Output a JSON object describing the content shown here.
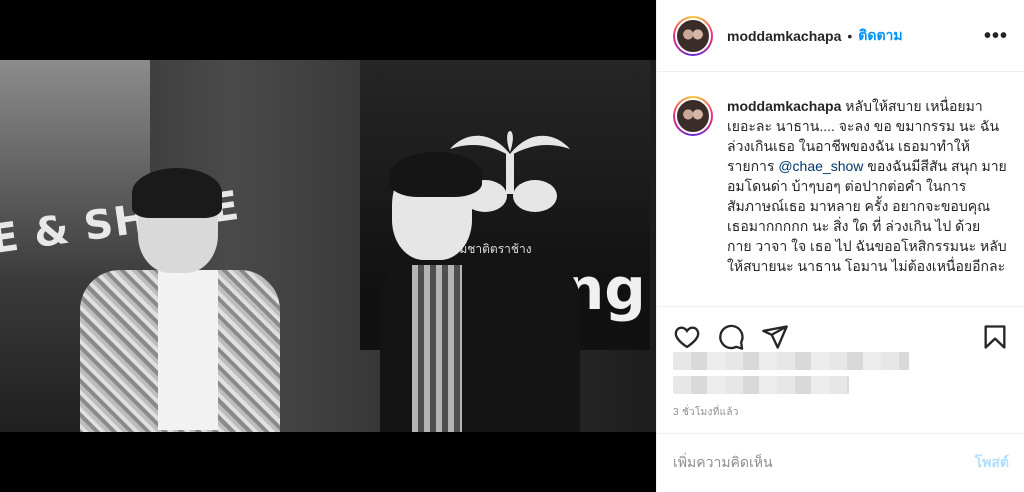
{
  "post": {
    "username": "moddamkachapa",
    "follow_label": "ติดตาม",
    "separator": "•",
    "more_label": "•••"
  },
  "photo": {
    "sign_text": "E & SHARE",
    "brand_line": "น้ำแร่ธรรมชาติตราช้าง",
    "brand_word": "Chang"
  },
  "caption": {
    "username": "moddamkachapa",
    "text_before_mention": " หลับให้สบาย เหนื่อยมาเยอะละ นาธาน.... จะลง ขอ ขมากรรม นะ ฉันล่วงเกินเธอ ในอาชีพของฉัน เธอมาทำให้รายการ ",
    "mention": "@chae_show",
    "text_after_mention": " ของฉันมีสีสัน สนุก มายอมโดนด่า บ้าๆบอๆ ต่อปากต่อคำ ในการสัมภาษณ์เธอ มาหลาย ครั้ง อยากจะขอบคุณเธอมากกกกก นะ สิ่ง ใด ที่ ล่วงเกิน ไป ด้วย กาย วาจา ใจ เธอ ไป ฉันขออโหสิกรรมนะ หลับให้สบายนะ นาธาน โอมาน ไม่ต้องเหนื่อยอีกละ"
  },
  "actions": {
    "icons": [
      "heart-icon",
      "comment-icon",
      "share-icon",
      "bookmark-icon"
    ]
  },
  "meta": {
    "time_ago": "3 ชั่วโมงที่แล้ว"
  },
  "comment_box": {
    "placeholder": "เพิ่มความคิดเห็น",
    "post_label": "โพสต์"
  },
  "colors": {
    "link": "#0095f6",
    "mention": "#00376b",
    "post_disabled": "#b2dffc",
    "muted": "#8e8e8e"
  }
}
